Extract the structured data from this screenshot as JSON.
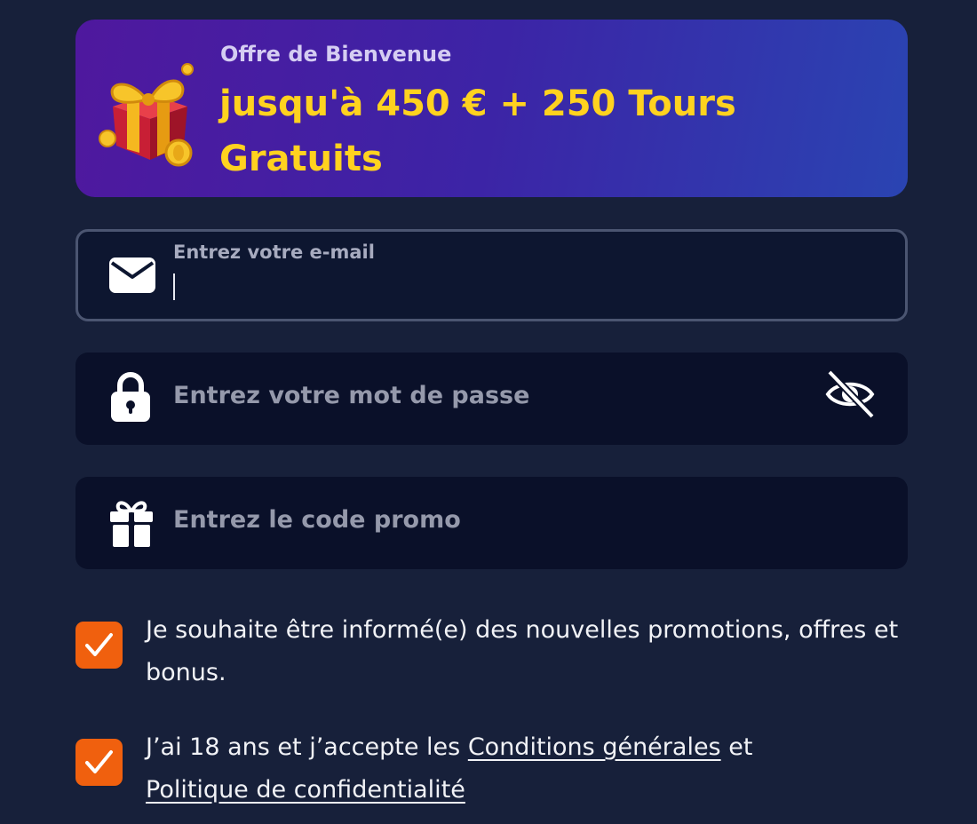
{
  "welcome": {
    "subtitle": "Offre de Bienvenue",
    "title": "jusqu'à 450 € + 250 Tours Gratuits",
    "gift_icon": "gift-box-with-coins"
  },
  "form": {
    "email": {
      "label": "Entrez votre e-mail",
      "value": "",
      "icon": "envelope"
    },
    "password": {
      "placeholder": "Entrez votre mot de passe",
      "icon": "lock",
      "toggle_icon": "eye-slash"
    },
    "promo": {
      "placeholder": "Entrez le code promo",
      "icon": "gift"
    }
  },
  "consents": {
    "promotions": {
      "checked": true,
      "text": "Je souhaite être informé(e) des nouvelles promotions, offres et bonus."
    },
    "terms": {
      "checked": true,
      "text_prefix": "J’ai 18 ans et j’accepte les",
      "terms_link": "Conditions générales",
      "joiner": "et",
      "privacy_link": "Politique de confidentialité"
    }
  },
  "colors": {
    "background": "#17203a",
    "accent_yellow": "#ffd21f",
    "checkbox_orange": "#f0600e",
    "field_background": "#0a1029"
  }
}
